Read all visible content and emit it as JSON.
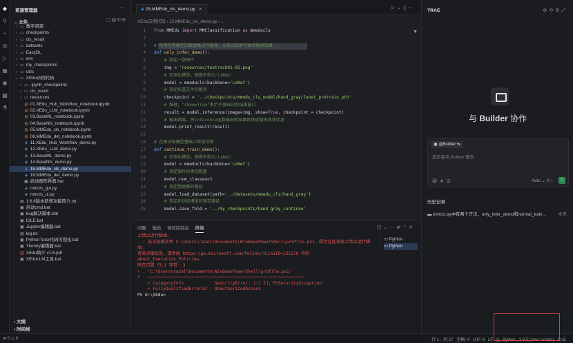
{
  "activity_icons": [
    "logo-icon",
    "search-icon",
    "git-icon",
    "source-control-icon",
    "debug-icon",
    "extensions-icon",
    "remote-icon",
    "grid-icon",
    "testing-icon"
  ],
  "explorer": {
    "title": "资源管理器",
    "section": "文件",
    "tree": [
      {
        "depth": 1,
        "kind": "folder",
        "label": "教学资源",
        "open": false
      },
      {
        "depth": 1,
        "kind": "folder",
        "label": "checkpoints",
        "open": false
      },
      {
        "depth": 1,
        "kind": "folder",
        "label": "cls_result",
        "open": false
      },
      {
        "depth": 1,
        "kind": "folder",
        "label": "datasets",
        "open": false
      },
      {
        "depth": 1,
        "kind": "folder",
        "label": "EasyDL",
        "open": false
      },
      {
        "depth": 1,
        "kind": "folder",
        "label": "env",
        "open": false
      },
      {
        "depth": 1,
        "kind": "folder",
        "label": "my_checkpoints",
        "open": false
      },
      {
        "depth": 1,
        "kind": "folder",
        "label": "utils",
        "open": false
      },
      {
        "depth": 1,
        "kind": "folder",
        "label": "XEdu示例代码",
        "open": true
      },
      {
        "depth": 2,
        "kind": "folder",
        "label": ".ipynb_checkpoints",
        "open": false
      },
      {
        "depth": 2,
        "kind": "folder",
        "label": "cls_result",
        "open": false
      },
      {
        "depth": 2,
        "kind": "folder",
        "label": "resources",
        "open": false
      },
      {
        "depth": 2,
        "kind": "nb",
        "label": "01.XEdu_Hub_Workflow_notebook.ipynb"
      },
      {
        "depth": 2,
        "kind": "nb",
        "label": "02.XEdu_LLM_notebook.ipynb"
      },
      {
        "depth": 2,
        "kind": "nb",
        "label": "03.BaseML_notebook.ipynb"
      },
      {
        "depth": 2,
        "kind": "nb",
        "label": "04.BaseNN_notebook.ipynb"
      },
      {
        "depth": 2,
        "kind": "nb",
        "label": "05.MMEdu_cls_notebook.ipynb"
      },
      {
        "depth": 2,
        "kind": "nb",
        "label": "06.MMEdu_det_notebook.ipynb"
      },
      {
        "depth": 2,
        "kind": "py",
        "label": "11.XEdu_Hub_Workflow_demo.py"
      },
      {
        "depth": 2,
        "kind": "py",
        "label": "12.XEdu_LLM_demo.py"
      },
      {
        "depth": 2,
        "kind": "py",
        "label": "13.BaseML_demo.py"
      },
      {
        "depth": 2,
        "kind": "py",
        "label": "14.BaseNN_demo.py"
      },
      {
        "depth": 2,
        "kind": "py",
        "label": "15.MMEdu_cls_demo.py",
        "selected": true
      },
      {
        "depth": 2,
        "kind": "py",
        "label": "16.MMEdu_det_demo.py"
      },
      {
        "depth": 2,
        "kind": "bat",
        "label": "启动图形界面.bat"
      },
      {
        "depth": 2,
        "kind": "py",
        "label": "mmcls_gui.py"
      },
      {
        "depth": 2,
        "kind": "py",
        "label": "mmcls_ui.py"
      },
      {
        "depth": 1,
        "kind": "txt",
        "label": "1.6.8版本新增功能简介.txt"
      },
      {
        "depth": 1,
        "kind": "bat",
        "label": "启动cmd.bat"
      },
      {
        "depth": 1,
        "kind": "bat",
        "label": "bug解决脚本.bat"
      },
      {
        "depth": 1,
        "kind": "bat",
        "label": "IDLE.bat"
      },
      {
        "depth": 1,
        "kind": "bat",
        "label": "Jupyter编辑器.bat"
      },
      {
        "depth": 1,
        "kind": "txt",
        "label": "log.txt"
      },
      {
        "depth": 1,
        "kind": "bat",
        "label": "PythonTutor代码可视化.bat"
      },
      {
        "depth": 1,
        "kind": "bat",
        "label": "Thonny编辑器.bat"
      },
      {
        "depth": 1,
        "kind": "pdf",
        "label": "XEdu简介 v1.6.pdf"
      },
      {
        "depth": 1,
        "kind": "bat",
        "label": "XEduLLM工具.bat"
      }
    ],
    "footer": [
      "大纲",
      "时间线"
    ]
  },
  "editor": {
    "tab_label": "15.MMEdu_cls_demo.py",
    "breadcrumb": "XEdu示例代码 › 15.MMEdu_cls_demo.py › ...",
    "lines": [
      {
        "n": "1",
        "html": "<span class='kw'>from</span> MMEdu <span class='kw'>import</span> MMClassification <span class='kw'>as</span> mmeducls"
      },
      {
        "n": "2",
        "html": ""
      },
      {
        "n": "3",
        "html": "<span class='cmt'># 使用内置模型的数据集进行推理，无需训练即可体验推理效果</span>",
        "hl": true
      },
      {
        "n": "4",
        "html": "<span class='kw2'>def</span> <span class='fn'>only_infer_demo</span>():"
      },
      {
        "n": "5",
        "html": "    <span class='cmt'># 指定一张图片</span>"
      },
      {
        "n": "6",
        "html": "    img = <span class='str'>'resources/testrock01-02.png'</span>"
      },
      {
        "n": "7",
        "html": "    <span class='cmt'># 实例化模型，网络名称为'LeNet'</span>"
      },
      {
        "n": "8",
        "html": "    model = mmeducls(backbone=<span class='str'>'LeNet'</span>)"
      },
      {
        "n": "9",
        "html": "    <span class='cmt'># 指定权重文件的路径</span>"
      },
      {
        "n": "10",
        "html": "    checkpoint = <span class='str'>'../checkpoints/mmedu_cls_model/hand_gray/lenet_pretrain.pth'</span>"
      },
      {
        "n": "11",
        "html": "    <span class='cmt'># 推理，\"show=True\"表示不弹出识别结果窗口</span>"
      },
      {
        "n": "12",
        "html": "    result = model.inference(image=img, show=<span class='kw'>True</span>, checkpoint = checkpoint)"
      },
      {
        "n": "13",
        "html": "    <span class='cmt'># 输出结果，将inference函数输出的结果修饰后输出具体信息</span>"
      },
      {
        "n": "14",
        "html": "    model.print_result(result)"
      },
      {
        "n": "15",
        "html": ""
      },
      {
        "n": "16",
        "html": "<span class='cmt'># 在预训练模型基础上继续训练</span>"
      },
      {
        "n": "17",
        "html": "<span class='kw2'>def</span> <span class='fn'>continue_train_demo</span>():"
      },
      {
        "n": "18",
        "html": "    <span class='cmt'># 实例化模型，网络名称为'LeNet'</span>"
      },
      {
        "n": "19",
        "html": "    model = mmeducls(backbone=<span class='str'>'LeNet'</span>)"
      },
      {
        "n": "20",
        "html": "    <span class='cmt'># 指定图片的类别数量</span>"
      },
      {
        "n": "21",
        "html": "    model.num_classes=<span class='num-c'>3</span>"
      },
      {
        "n": "22",
        "html": "    <span class='cmt'># 指定数据集的路径</span>"
      },
      {
        "n": "23",
        "html": "    model.load_dataset(path=<span class='str'>'../datasets/mmedu_cls/hand_gray'</span>)"
      },
      {
        "n": "24",
        "html": "    <span class='cmt'># 指定新训练模型的保存路径</span>"
      },
      {
        "n": "25",
        "html": "    model.save_fold = <span class='str'>'../my_checkpoints/hand_gray_continue'</span>"
      }
    ]
  },
  "panel": {
    "tabs": [
      "问题",
      "输出",
      "调试控制台",
      "终端"
    ],
    "active_tab": "终端",
    "terminal_lines": [
      {
        "t": "err",
        "text": "上禁止运行脚本。"
      },
      {
        "t": "err",
        "text": ". : 无法加载文件 C:\\Users\\razel\\Documents\\WindowsPowerShell\\profile.ps1，因为在此系统上禁止运行脚本。"
      },
      {
        "t": "err",
        "text": "有关详细信息，请参阅 https:/go.microsoft.com/fwlink/?LinkID=135170 中的 about_Execution_Policies。"
      },
      {
        "t": "err",
        "text": "所在位置 行:1 字符: 3"
      },
      {
        "t": "err",
        "text": "+ . 'C:\\Users\\razel\\Documents\\WindowsPowerShell\\profile.ps1'"
      },
      {
        "t": "err",
        "text": "+   ~~~~~~~~~~~~~~~~~~~~~~~~~~~~~~~~~~~~~~~~~~~~~~~~~~~~~~~~~~~~~"
      },
      {
        "t": "err",
        "text": "    + CategoryInfo          : SecurityError: (:) []，PSSecurityException"
      },
      {
        "t": "err",
        "text": "    + FullyQualifiedErrorId : UnauthorizedAccess"
      },
      {
        "t": "norm",
        "text": "PS D:\\XEdu>"
      }
    ],
    "terminals": [
      "Python",
      "Python"
    ]
  },
  "right": {
    "title": "TRAE",
    "builder_prefix": "与 ",
    "builder_name": "Builder",
    "builder_suffix": " 协作",
    "chip": "@Builder",
    "placeholder": "您正在与 Builder 聊天",
    "model": "Auto",
    "history_title": "历史记录",
    "history_item": "mmcls.py中有两个方法，only_infer_demo和normal_train...",
    "history_time": "今天"
  },
  "status": {
    "left": "⊗ 0 ⚠ 0",
    "items": [
      "行 1，列 27",
      "空格: 4",
      "UTF-8",
      "LF",
      "{}",
      "Python",
      "3.8.5 ('env': conda)",
      "CUE"
    ]
  },
  "colors": {
    "accent": "#2b3a55",
    "error": "#e2564f",
    "highlight_box": "#d6453d",
    "send": "#2e8a4f"
  }
}
